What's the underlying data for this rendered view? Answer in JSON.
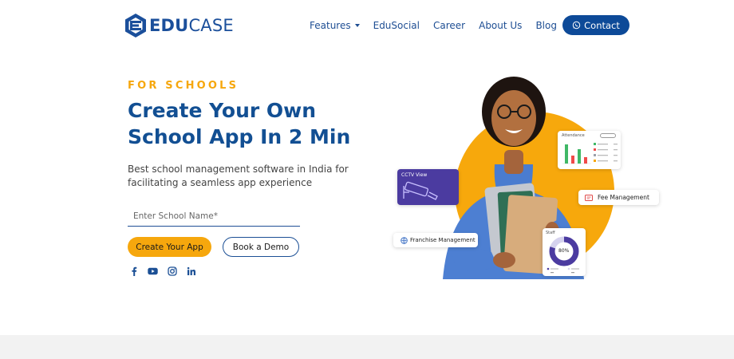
{
  "brand": {
    "logo_part1": "EDU",
    "logo_part2": "CASE",
    "primary_color": "#124f93",
    "accent_color": "#f6a70d"
  },
  "nav": {
    "items": [
      {
        "label": "Features",
        "has_dropdown": true
      },
      {
        "label": "EduSocial"
      },
      {
        "label": "Career"
      },
      {
        "label": "About Us"
      },
      {
        "label": "Blog"
      }
    ],
    "contact_label": "Contact",
    "contact_icon": "whatsapp-icon"
  },
  "hero": {
    "eyebrow": "FOR SCHOOLS",
    "title_line1": "Create Your Own",
    "title_line2": "School App In 2 Min",
    "subtitle": "Best school management software in India for facilitating a seamless app experience",
    "input_placeholder": "Enter School Name*",
    "input_value": "",
    "primary_button": "Create Your App",
    "secondary_button": "Book a Demo",
    "social_icons": [
      "facebook-icon",
      "youtube-icon",
      "instagram-icon",
      "linkedin-icon"
    ]
  },
  "illustration": {
    "cctv_card_label": "CCTV View",
    "attendance_card_title": "Attendance",
    "fee_card_label": "Fee Management",
    "franchise_card_label": "Franchise Management",
    "staff_card_title": "Staff",
    "staff_percent": "80%",
    "staff_donut_fraction": 0.8
  }
}
